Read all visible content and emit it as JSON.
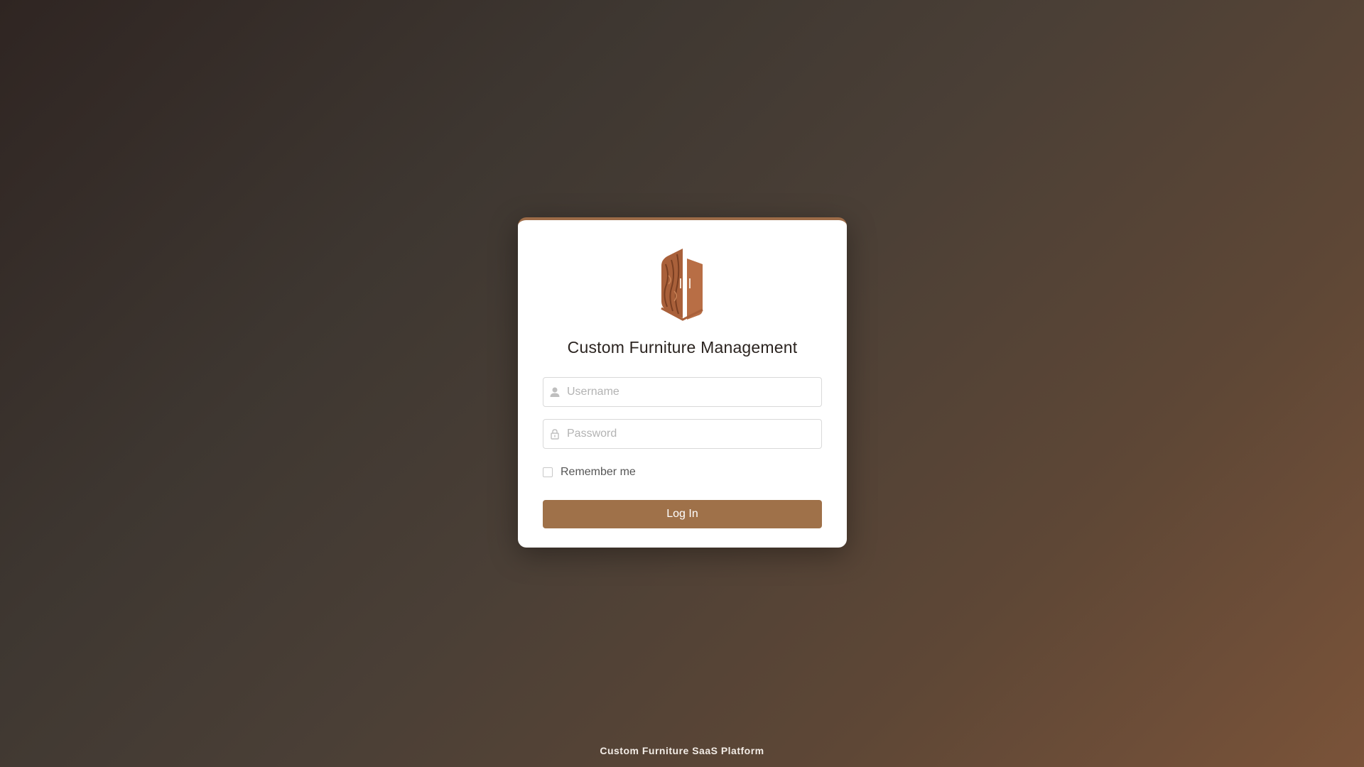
{
  "login": {
    "title": "Custom Furniture Management",
    "username": {
      "value": "",
      "placeholder": "Username",
      "icon": "user-icon"
    },
    "password": {
      "value": "",
      "placeholder": "Password",
      "icon": "lock-icon"
    },
    "remember_label": "Remember me",
    "remember_checked": false,
    "submit_label": "Log In"
  },
  "footer": {
    "text": "Custom Furniture SaaS Platform"
  },
  "colors": {
    "accent": "#9f7149",
    "logo_wood": "#a9603a",
    "card": "#ffffff"
  }
}
